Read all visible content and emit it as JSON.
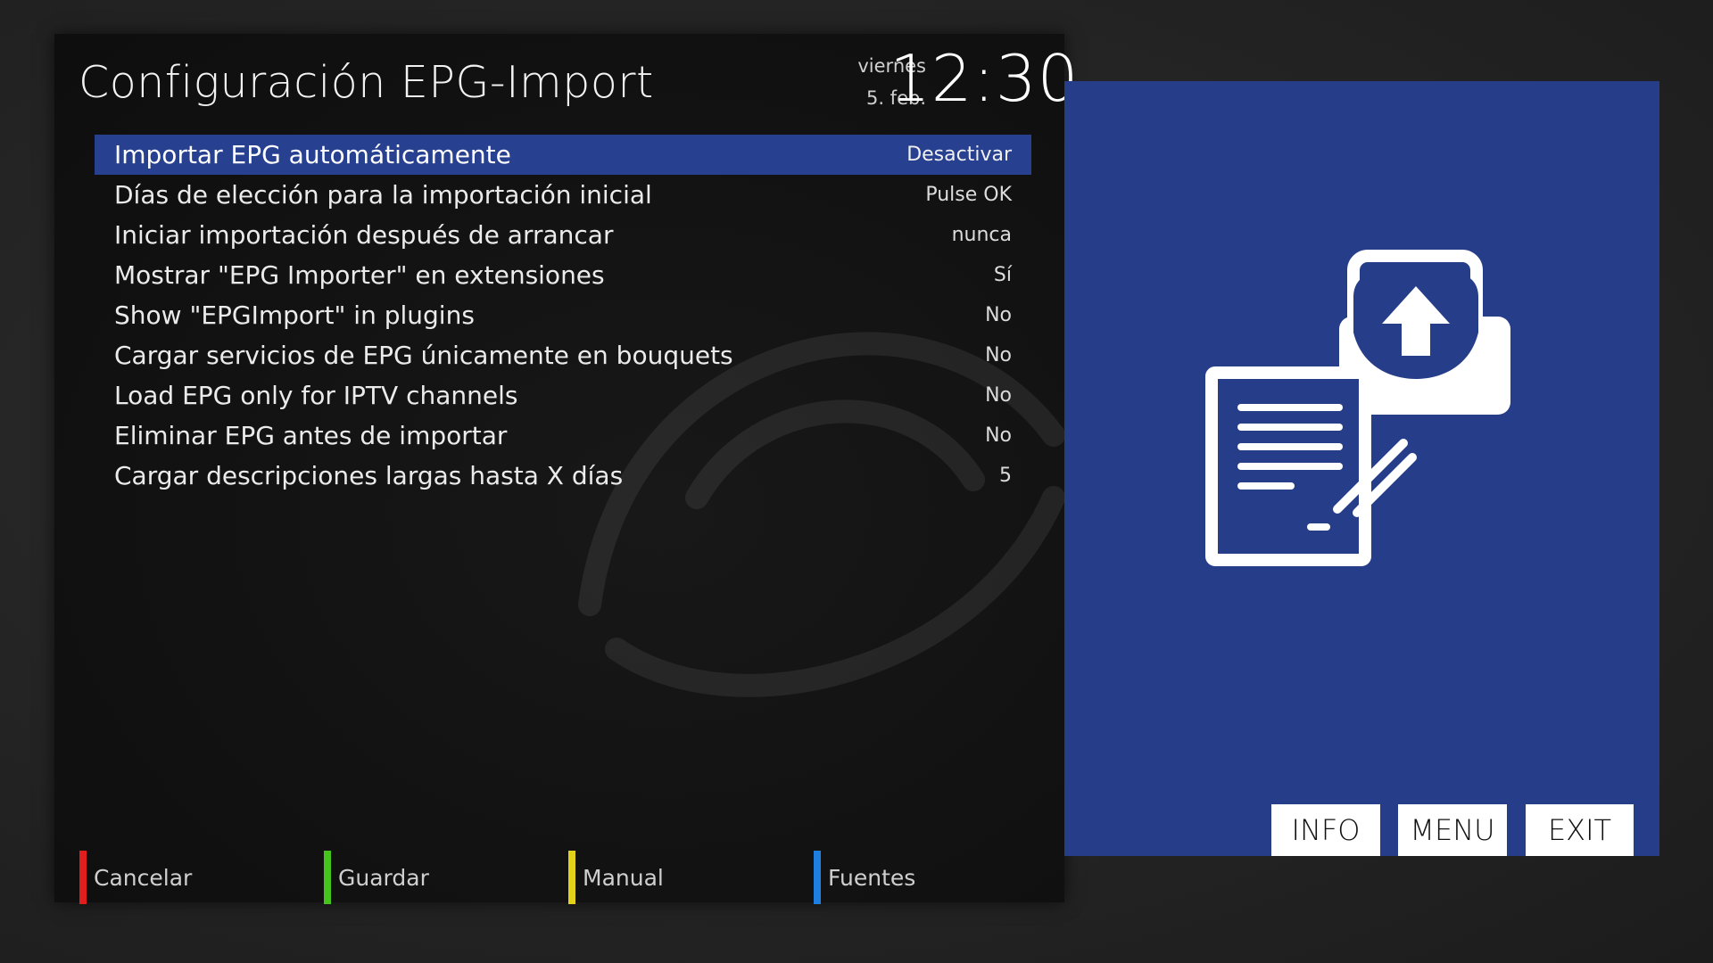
{
  "header": {
    "title": "Configuración EPG-Import",
    "day": "viernes",
    "date": "5. feb.",
    "time": "12:30"
  },
  "settings": [
    {
      "label": "Importar EPG automáticamente",
      "value": "Desactivar",
      "selected": true
    },
    {
      "label": "Días de elección para la importación inicial",
      "value": "Pulse OK"
    },
    {
      "label": "Iniciar importación después de arrancar",
      "value": "nunca"
    },
    {
      "label": "Mostrar \"EPG Importer\" en extensiones",
      "value": "Sí"
    },
    {
      "label": "Show \"EPGImport\" in plugins",
      "value": "No"
    },
    {
      "label": "Cargar servicios de EPG únicamente en bouquets",
      "value": "No"
    },
    {
      "label": "Load EPG only for IPTV channels",
      "value": "No"
    },
    {
      "label": "Eliminar EPG antes de importar",
      "value": "No"
    },
    {
      "label": "Cargar descripciones largas hasta X días",
      "value": "5"
    }
  ],
  "color_keys": [
    {
      "label": "Cancelar",
      "color": "#e01e1e"
    },
    {
      "label": "Guardar",
      "color": "#45c41e"
    },
    {
      "label": "Manual",
      "color": "#e4d21a"
    },
    {
      "label": "Fuentes",
      "color": "#1e7fe0"
    }
  ],
  "hint_buttons": {
    "info": "INFO",
    "menu": "MENU",
    "exit": "EXIT"
  },
  "preview": {
    "background": "#263e8a",
    "icon": "document-upload-icon"
  }
}
